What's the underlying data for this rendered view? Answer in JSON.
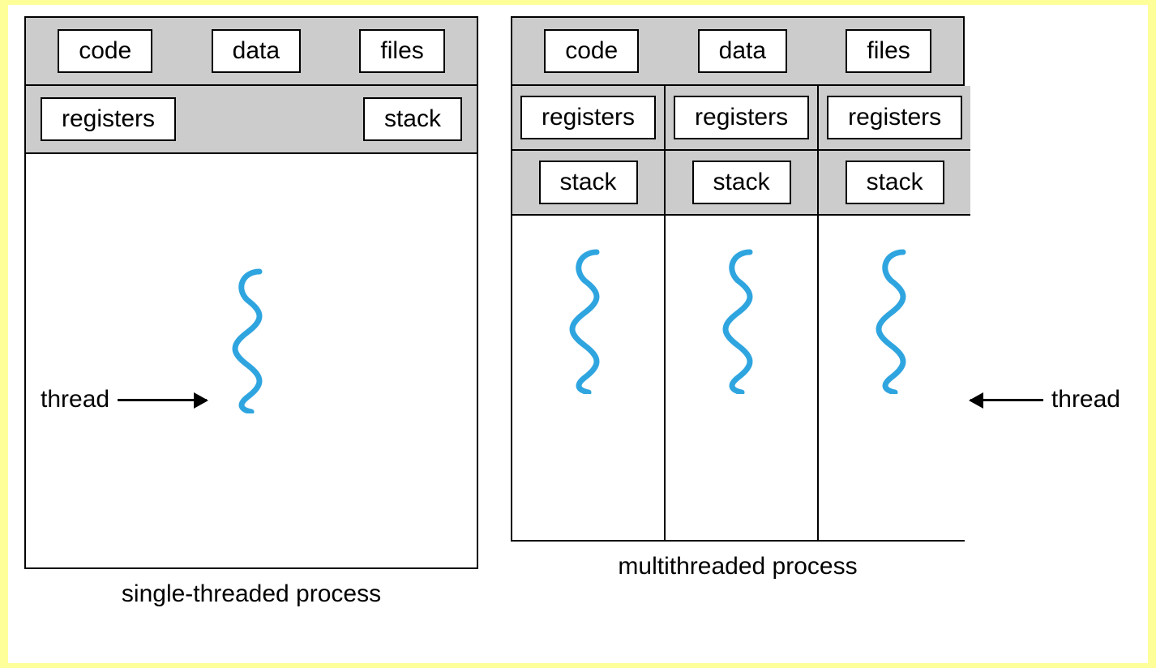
{
  "single": {
    "shared": [
      "code",
      "data",
      "files"
    ],
    "registers": "registers",
    "stack": "stack",
    "thread_label": "thread",
    "caption": "single-threaded process"
  },
  "multi": {
    "shared": [
      "code",
      "data",
      "files"
    ],
    "threads": [
      {
        "registers": "registers",
        "stack": "stack"
      },
      {
        "registers": "registers",
        "stack": "stack"
      },
      {
        "registers": "registers",
        "stack": "stack"
      }
    ],
    "thread_label": "thread",
    "caption": "multithreaded process"
  },
  "colors": {
    "thread_stroke": "#2fa5e0",
    "gray_fill": "#cccccc",
    "page_bg": "#ffff99"
  }
}
